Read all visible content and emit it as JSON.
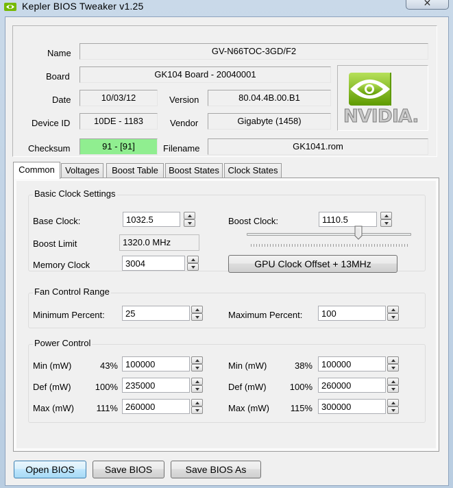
{
  "window": {
    "title": "Kepler BIOS Tweaker v1.25",
    "close_glyph": "✕"
  },
  "info": {
    "name_label": "Name",
    "name_value": "GV-N66TOC-3GD/F2",
    "board_label": "Board",
    "board_value": "GK104 Board - 20040001",
    "date_label": "Date",
    "date_value": "10/03/12",
    "version_label": "Version",
    "version_value": "80.04.4B.00.B1",
    "device_label": "Device ID",
    "device_value": "10DE - 1183",
    "vendor_label": "Vendor",
    "vendor_value": "Gigabyte (1458)",
    "checksum_label": "Checksum",
    "checksum_value": "91 - [91]",
    "filename_label": "Filename",
    "filename_value": "GK1041.rom",
    "logo_text": "NVIDIA."
  },
  "tabs": [
    "Common",
    "Voltages",
    "Boost Table",
    "Boost States",
    "Clock States"
  ],
  "clock": {
    "group_title": "Basic Clock Settings",
    "base_label": "Base Clock:",
    "base_value": "1032.5",
    "boost_label": "Boost Clock:",
    "boost_value": "1110.5",
    "limit_label": "Boost Limit",
    "limit_value": "1320.0 MHz",
    "memory_label": "Memory Clock",
    "memory_value": "3004",
    "offset_button": "GPU Clock Offset + 13MHz",
    "slider_position": 0.68
  },
  "fan": {
    "group_title": "Fan Control Range",
    "min_label": "Minimum Percent:",
    "min_value": "25",
    "max_label": "Maximum Percent:",
    "max_value": "100"
  },
  "power": {
    "group_title": "Power Control",
    "left": [
      {
        "label": "Min (mW)",
        "pct": "43%",
        "value": "100000"
      },
      {
        "label": "Def (mW)",
        "pct": "100%",
        "value": "235000"
      },
      {
        "label": "Max (mW)",
        "pct": "111%",
        "value": "260000"
      }
    ],
    "right": [
      {
        "label": "Min (mW)",
        "pct": "38%",
        "value": "100000"
      },
      {
        "label": "Def (mW)",
        "pct": "100%",
        "value": "260000"
      },
      {
        "label": "Max (mW)",
        "pct": "115%",
        "value": "300000"
      }
    ]
  },
  "buttons": {
    "open": "Open BIOS",
    "save": "Save BIOS",
    "save_as": "Save BIOS As"
  },
  "colors": {
    "checksum_ok": "#90ee90",
    "nvidia_green": "#76b900"
  }
}
